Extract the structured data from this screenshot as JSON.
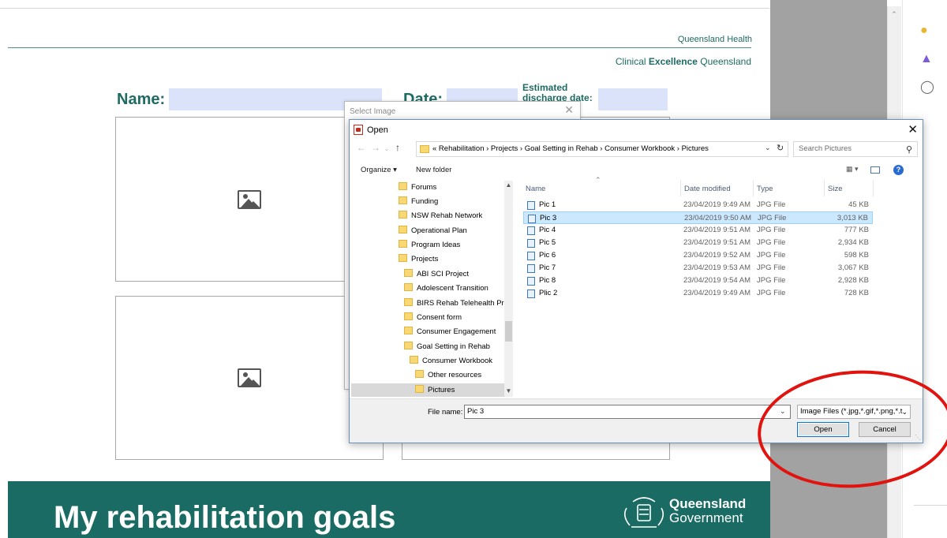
{
  "document": {
    "header_org": "Queensland Health",
    "header_unit_prefix": "Clinical ",
    "header_unit_bold": "Excellence",
    "header_unit_suffix": " Queensland",
    "name_label": "Name:",
    "date_label": "Date:",
    "discharge_label": "Estimated discharge date:",
    "banner_title": "My rehabilitation goals",
    "gov_line1": "Queensland",
    "gov_line2": "Government",
    "image_placeholder_icon": "picture-placeholder-icon"
  },
  "select_image_dialog": {
    "title": "Select Image",
    "close": "✕"
  },
  "open_dialog": {
    "title": "Open",
    "close": "✕",
    "address_path": "«  Rehabilitation  ›  Projects  ›  Goal Setting in Rehab  ›  Consumer Workbook  ›  Pictures",
    "search_placeholder": "Search Pictures",
    "organize_label": "Organize ▾",
    "new_folder_label": "New folder",
    "nav_items": [
      {
        "label": "Forums"
      },
      {
        "label": "Funding"
      },
      {
        "label": "NSW Rehab Network"
      },
      {
        "label": "Operational Plan"
      },
      {
        "label": "Program Ideas"
      },
      {
        "label": "Projects"
      },
      {
        "label": "ABI SCI Project"
      },
      {
        "label": "Adolescent Transition"
      },
      {
        "label": "BIRS Rehab Telehealth Proje"
      },
      {
        "label": "Consent form"
      },
      {
        "label": "Consumer Engagement"
      },
      {
        "label": "Goal Setting in Rehab"
      },
      {
        "label": "Consumer Workbook"
      },
      {
        "label": "Other resources"
      },
      {
        "label": "Pictures"
      }
    ],
    "columns": {
      "name": "Name",
      "date": "Date modified",
      "type": "Type",
      "size": "Size"
    },
    "files": [
      {
        "name": "Pic 1",
        "date": "23/04/2019 9:49 AM",
        "type": "JPG File",
        "size": "45 KB"
      },
      {
        "name": "Pic 3",
        "date": "23/04/2019 9:50 AM",
        "type": "JPG File",
        "size": "3,013 KB"
      },
      {
        "name": "Pic 4",
        "date": "23/04/2019 9:51 AM",
        "type": "JPG File",
        "size": "777 KB"
      },
      {
        "name": "Pic 5",
        "date": "23/04/2019 9:51 AM",
        "type": "JPG File",
        "size": "2,934 KB"
      },
      {
        "name": "Pic 6",
        "date": "23/04/2019 9:52 AM",
        "type": "JPG File",
        "size": "598 KB"
      },
      {
        "name": "Pic 7",
        "date": "23/04/2019 9:53 AM",
        "type": "JPG File",
        "size": "3,067 KB"
      },
      {
        "name": "Pic 8",
        "date": "23/04/2019 9:54 AM",
        "type": "JPG File",
        "size": "2,928 KB"
      },
      {
        "name": "Plic 2",
        "date": "23/04/2019 9:49 AM",
        "type": "JPG File",
        "size": "728 KB"
      }
    ],
    "selected_file": "Pic 3",
    "file_name_label": "File name:",
    "file_name_value": "Pic 3",
    "file_type_value": "Image Files (*.jpg,*.gif,*.png,*.t",
    "open_button": "Open",
    "cancel_button": "Cancel"
  },
  "colors": {
    "brand_teal": "#1a6b64",
    "field_fill": "#dbe3fb",
    "selection": "#cce8ff",
    "annotation_red": "#e1130e"
  }
}
